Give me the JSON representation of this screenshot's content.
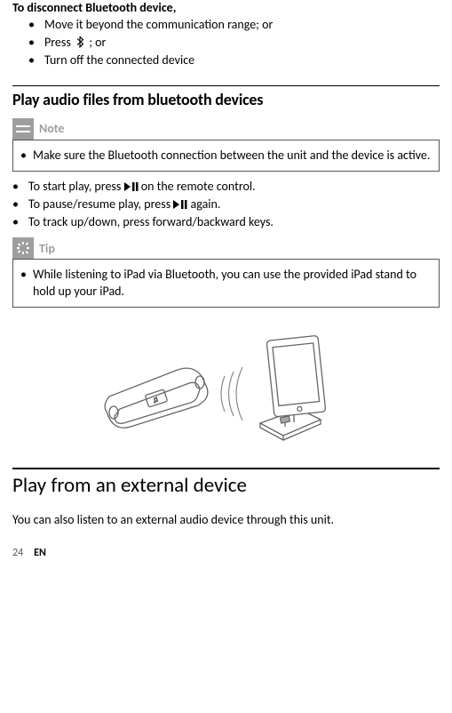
{
  "disconnect": {
    "title": "To disconnect Bluetooth device,",
    "items": [
      "Move it beyond the communication range; or",
      "Press ",
      "Turn off the connected device"
    ],
    "press_suffix": "; or"
  },
  "play_bt": {
    "heading": "Play audio files from bluetooth devices",
    "note_label": "Note",
    "note_text": "Make sure the Bluetooth connection between the unit and the device is active.",
    "steps": {
      "start_pre": "To start play, press ",
      "start_post": " on the remote control.",
      "pause_pre": "To pause/resume play, press ",
      "pause_post": " again.",
      "track": "To track up/down, press forward/backward keys."
    },
    "tip_label": "Tip",
    "tip_text": "While listening to iPad via Bluetooth, you can use the provided iPad stand to hold up your iPad."
  },
  "external": {
    "heading": "Play from an external device",
    "text": "You can also listen to an external audio device through this unit."
  },
  "footer": {
    "page": "24",
    "lang": "EN"
  }
}
